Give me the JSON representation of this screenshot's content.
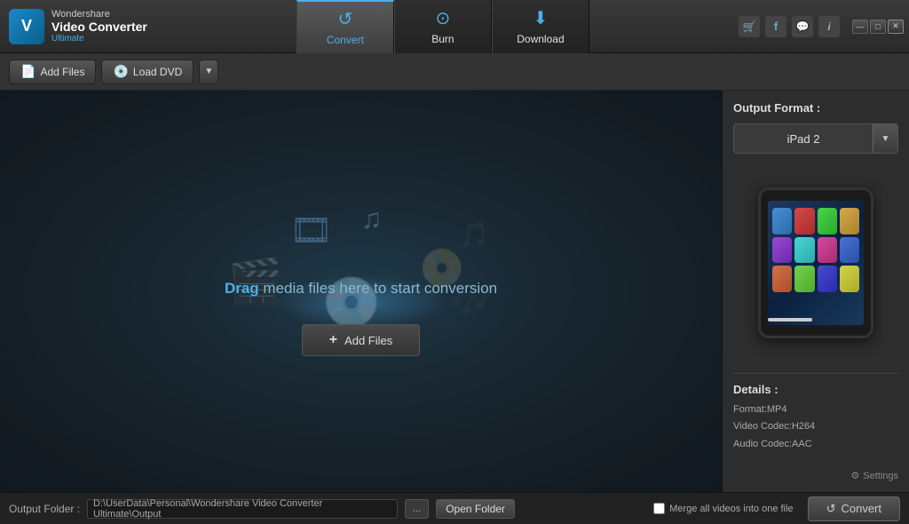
{
  "app": {
    "company": "Wondershare",
    "name": "Video Converter",
    "edition": "Ultimate"
  },
  "tabs": [
    {
      "id": "convert",
      "label": "Convert",
      "icon": "⟳",
      "active": true
    },
    {
      "id": "burn",
      "label": "Burn",
      "icon": "⊙"
    },
    {
      "id": "download",
      "label": "Download",
      "icon": "⬇"
    }
  ],
  "toolbar": {
    "add_files_label": "Add Files",
    "load_dvd_label": "Load DVD"
  },
  "drop_zone": {
    "drag_text_bold": "Drag",
    "drag_text_rest": " media files here to start conversion",
    "add_files_label": "Add Files"
  },
  "output_format": {
    "label": "Output Format :",
    "selected": "iPad 2"
  },
  "details": {
    "label": "Details :",
    "format": "Format:MP4",
    "video_codec": "Video Codec:H264",
    "audio_codec": "Audio Codec:AAC"
  },
  "settings": {
    "label": "Settings"
  },
  "bottom_bar": {
    "output_folder_label": "Output Folder :",
    "output_path": "D:\\UserData\\Personal\\Wondershare Video Converter Ultimate\\Output",
    "browse_label": "...",
    "open_folder_label": "Open Folder",
    "merge_label": "Merge all videos into one file",
    "convert_label": "Convert"
  },
  "window_controls": {
    "minimize": "—",
    "maximize": "□",
    "close": "✕"
  },
  "header_icons": {
    "cart": "🛒",
    "facebook": "f",
    "chat": "✉",
    "info": "i"
  }
}
